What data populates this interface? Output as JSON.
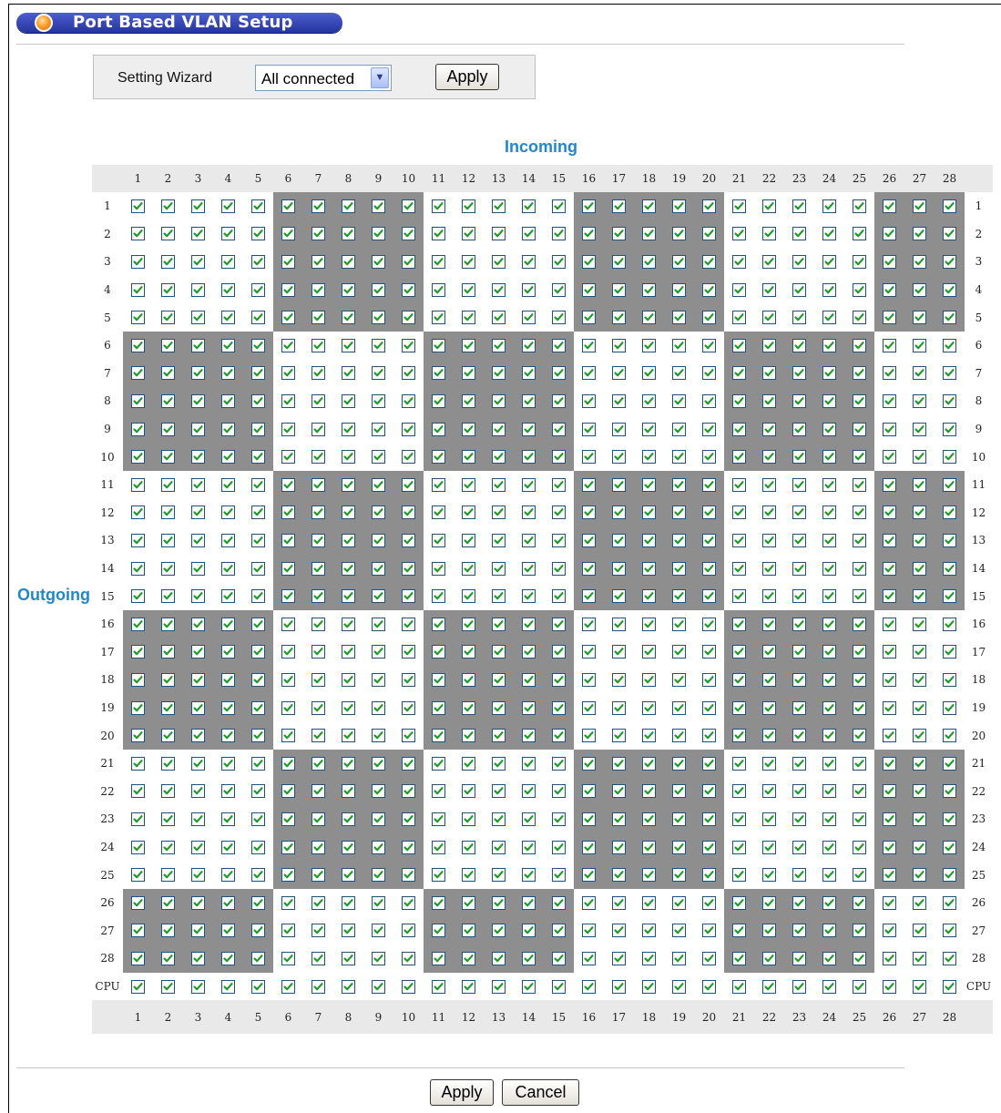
{
  "title": "Port Based VLAN Setup",
  "wizard": {
    "label": "Setting Wizard",
    "selected": "All connected",
    "apply_label": "Apply"
  },
  "matrix": {
    "incoming_label": "Incoming",
    "outgoing_label": "Outgoing",
    "ports": [
      "1",
      "2",
      "3",
      "4",
      "5",
      "6",
      "7",
      "8",
      "9",
      "10",
      "11",
      "12",
      "13",
      "14",
      "15",
      "16",
      "17",
      "18",
      "19",
      "20",
      "21",
      "22",
      "23",
      "24",
      "25",
      "26",
      "27",
      "28"
    ],
    "cpu_label": "CPU",
    "all_checked": true
  },
  "footer": {
    "apply_label": "Apply",
    "cancel_label": "Cancel"
  },
  "colors": {
    "title_bar": "#2b3ca8",
    "axis_label": "#1f88c9",
    "shaded_cell": "#8e8e8e",
    "check": "#1f9a2a"
  }
}
